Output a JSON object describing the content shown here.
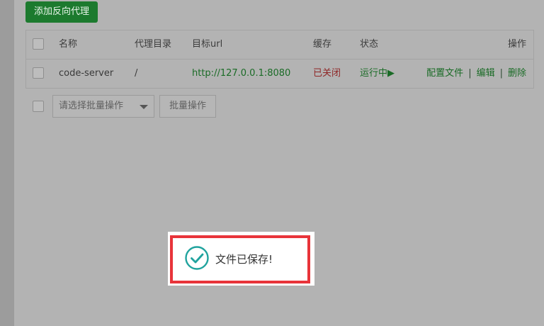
{
  "toolbar": {
    "add_proxy_label": "添加反向代理"
  },
  "table": {
    "headers": {
      "name": "名称",
      "proxy_dir": "代理目录",
      "target_url": "目标url",
      "cache": "缓存",
      "status": "状态",
      "actions": "操作"
    },
    "rows": [
      {
        "name": "code-server",
        "proxy_dir": "/",
        "target_url": "http://127.0.0.1:8080",
        "cache": "已关闭",
        "status": "运行中▶",
        "action_config": "配置文件",
        "action_edit": "编辑",
        "action_delete": "删除",
        "separator": "|"
      }
    ]
  },
  "bulk": {
    "select_placeholder": "请选择批量操作",
    "button_label": "批量操作"
  },
  "toast": {
    "message": "文件已保存!"
  },
  "colors": {
    "primary_green": "#1c7a2e",
    "link_green": "#1a6b26",
    "status_red": "#8f2727",
    "toast_icon": "#20a39e",
    "highlight_border": "#e8343a"
  }
}
